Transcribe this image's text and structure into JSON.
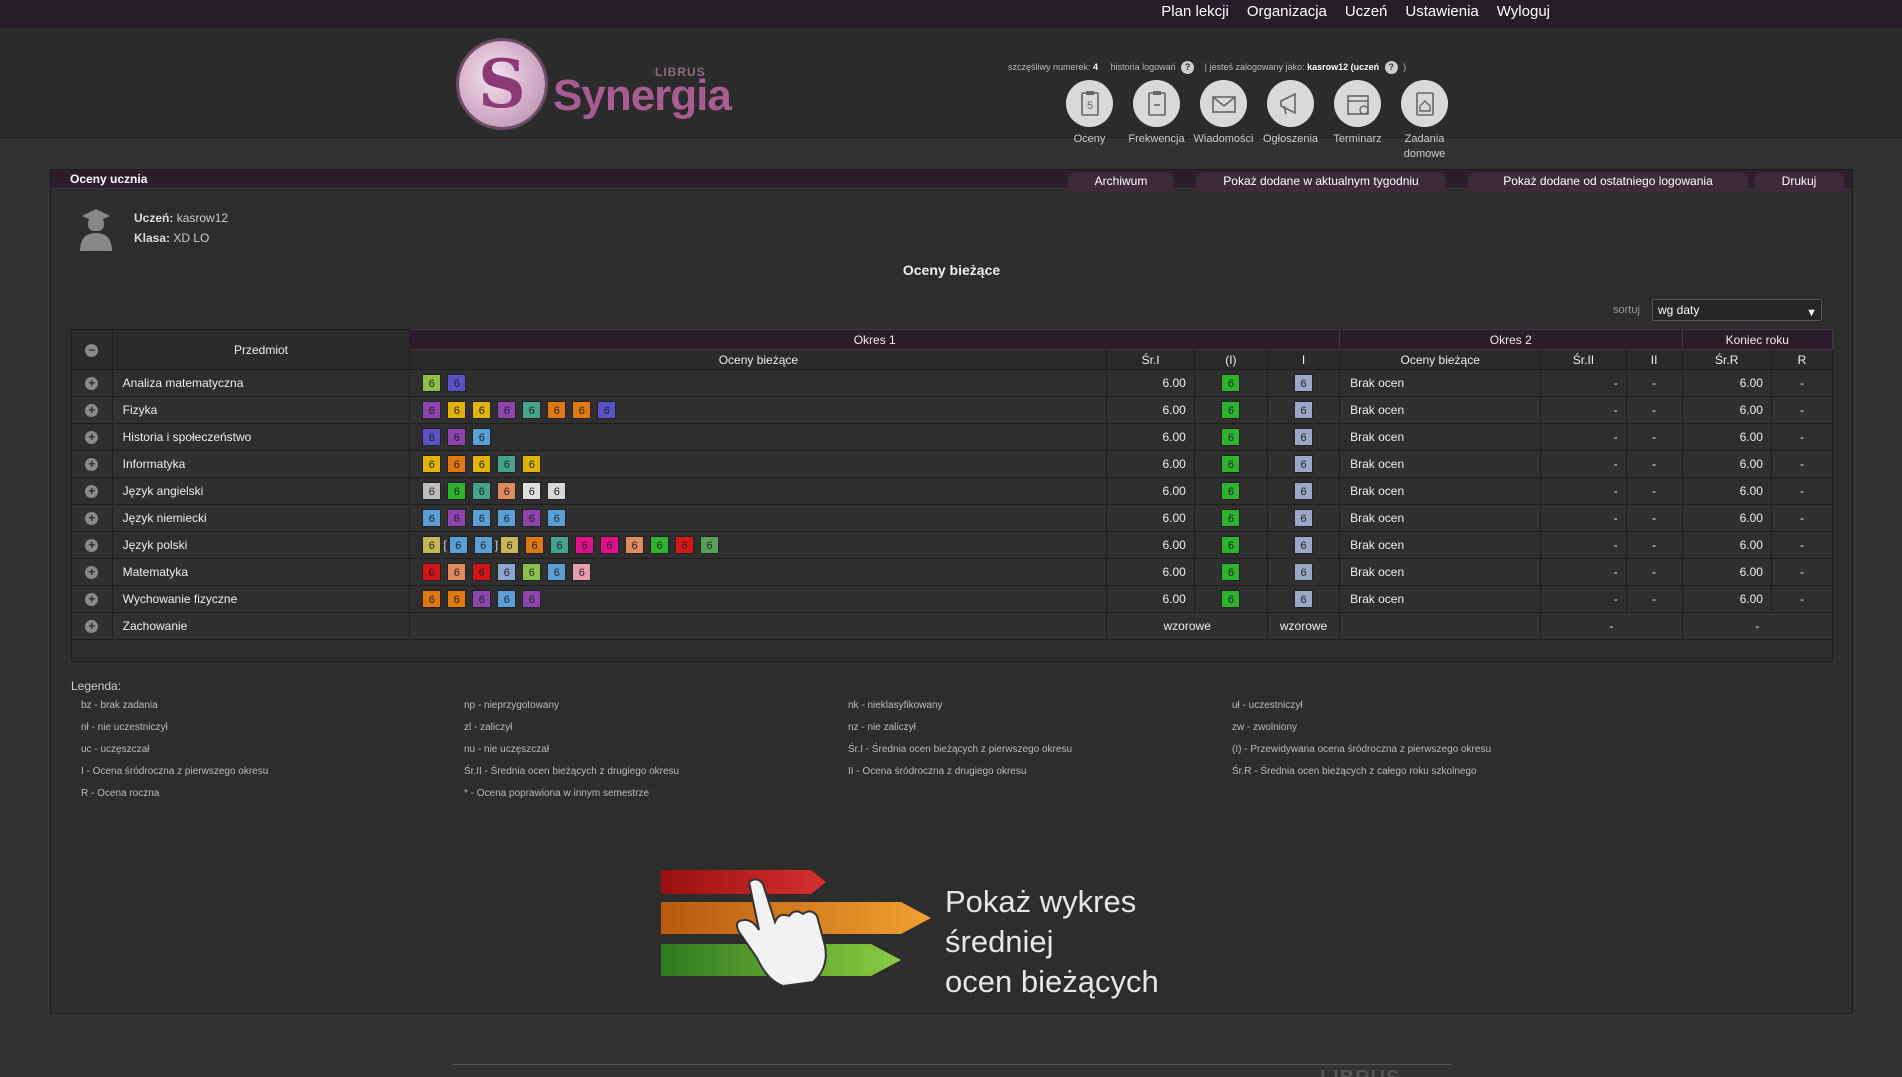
{
  "topnav": {
    "items": [
      "Plan lekcji",
      "Organizacja",
      "Uczeń",
      "Ustawienia",
      "Wyloguj"
    ]
  },
  "logo": {
    "name": "Synergia",
    "brand": "LIBRUS"
  },
  "infobar": {
    "lucky_label": "szczęśliwy numerek:",
    "lucky_value": "4",
    "history_label": "historia logowań",
    "logged_label": "| jesteś zalogowany jako:",
    "logged_value": "kasrow12 (uczeń",
    "close": ")"
  },
  "icons": [
    {
      "label": "Oceny",
      "icon": "grades-icon"
    },
    {
      "label": "Frekwencja",
      "icon": "attendance-icon"
    },
    {
      "label": "Wiadomości",
      "icon": "messages-icon"
    },
    {
      "label": "Ogłoszenia",
      "icon": "announcements-icon"
    },
    {
      "label": "Terminarz",
      "icon": "calendar-icon"
    },
    {
      "label": "Zadania domowe",
      "icon": "homework-icon"
    }
  ],
  "panel": {
    "title": "Oceny ucznia",
    "tabs": [
      "Archiwum",
      "Pokaż dodane w aktualnym tygodniu",
      "Pokaż dodane od ostatniego logowania",
      "Drukuj"
    ]
  },
  "student": {
    "name_label": "Uczeń:",
    "name": "kasrow12",
    "class_label": "Klasa:",
    "class": "XD LO"
  },
  "section_title": "Oceny bieżące",
  "sort": {
    "label": "sortuj",
    "value": "wg daty"
  },
  "table": {
    "headers": {
      "subject": "Przedmiot",
      "okres1": "Okres 1",
      "okres2": "Okres 2",
      "end": "Koniec roku",
      "grades1": "Oceny bieżące",
      "sr1": "Śr.I",
      "pred1": "(I)",
      "i": "I",
      "grades2": "Oceny bieżące",
      "sr2": "Śr.II",
      "ii": "II",
      "srr": "Śr.R",
      "r": "R"
    },
    "rows": [
      {
        "subject": "Analiza matematyczna",
        "grades": [
          {
            "v": "6",
            "c": "#8bc34a"
          },
          {
            "v": "6",
            "c": "#5a53c7"
          }
        ],
        "sr1": "6.00",
        "pred": "6",
        "i": "6",
        "grades2": "Brak ocen",
        "sr2": "-",
        "ii": "-",
        "srr": "6.00",
        "r": "-"
      },
      {
        "subject": "Fizyka",
        "grades": [
          {
            "v": "6",
            "c": "#8e44ad"
          },
          {
            "v": "6",
            "c": "#e0b400"
          },
          {
            "v": "6",
            "c": "#e0b400"
          },
          {
            "v": "6",
            "c": "#8e44ad"
          },
          {
            "v": "6",
            "c": "#45a58c"
          },
          {
            "v": "6",
            "c": "#e07a10"
          },
          {
            "v": "6",
            "c": "#e07a10"
          },
          {
            "v": "6",
            "c": "#5a53c7"
          }
        ],
        "sr1": "6.00",
        "pred": "6",
        "i": "6",
        "grades2": "Brak ocen",
        "sr2": "-",
        "ii": "-",
        "srr": "6.00",
        "r": "-"
      },
      {
        "subject": "Historia i społeczeństwo",
        "grades": [
          {
            "v": "6",
            "c": "#5a53c7"
          },
          {
            "v": "6",
            "c": "#8e44ad"
          },
          {
            "v": "6",
            "c": "#5a9fd6"
          }
        ],
        "sr1": "6.00",
        "pred": "6",
        "i": "6",
        "grades2": "Brak ocen",
        "sr2": "-",
        "ii": "-",
        "srr": "6.00",
        "r": "-"
      },
      {
        "subject": "Informatyka",
        "grades": [
          {
            "v": "6",
            "c": "#e0b400"
          },
          {
            "v": "6",
            "c": "#e07a10"
          },
          {
            "v": "6",
            "c": "#e0b400"
          },
          {
            "v": "6",
            "c": "#45a58c"
          },
          {
            "v": "6",
            "c": "#e0b400"
          }
        ],
        "sr1": "6.00",
        "pred": "6",
        "i": "6",
        "grades2": "Brak ocen",
        "sr2": "-",
        "ii": "-",
        "srr": "6.00",
        "r": "-"
      },
      {
        "subject": "Język angielski",
        "grades": [
          {
            "v": "6",
            "c": "#bdbdbd"
          },
          {
            "v": "6",
            "c": "#2db32d"
          },
          {
            "v": "6",
            "c": "#45a58c"
          },
          {
            "v": "6",
            "c": "#e08a60"
          },
          {
            "v": "6",
            "c": "#e0e0e0"
          },
          {
            "v": "6",
            "c": "#d8d8d8"
          }
        ],
        "sr1": "6.00",
        "pred": "6",
        "i": "6",
        "grades2": "Brak ocen",
        "sr2": "-",
        "ii": "-",
        "srr": "6.00",
        "r": "-"
      },
      {
        "subject": "Język niemiecki",
        "grades": [
          {
            "v": "6",
            "c": "#5a9fd6"
          },
          {
            "v": "6",
            "c": "#8e44ad"
          },
          {
            "v": "6",
            "c": "#5a9fd6"
          },
          {
            "v": "6",
            "c": "#5a9fd6"
          },
          {
            "v": "6",
            "c": "#8e44ad"
          },
          {
            "v": "6",
            "c": "#5a9fd6"
          }
        ],
        "sr1": "6.00",
        "pred": "6",
        "i": "6",
        "grades2": "Brak ocen",
        "sr2": "-",
        "ii": "-",
        "srr": "6.00",
        "r": "-"
      },
      {
        "subject": "Język polski",
        "special": true,
        "grades": [
          {
            "v": "6",
            "c": "#c9b458"
          },
          {
            "v": "[",
            "br": true
          },
          {
            "v": "6",
            "c": "#5a9fd6"
          },
          {
            "v": "6",
            "c": "#5a9fd6"
          },
          {
            "v": "]",
            "br": true
          },
          {
            "v": "6",
            "c": "#c9b458"
          },
          {
            "v": "6",
            "c": "#e07a10"
          },
          {
            "v": "6",
            "c": "#45a58c"
          },
          {
            "v": "6",
            "c": "#e0108a"
          },
          {
            "v": "6",
            "c": "#e0108a"
          },
          {
            "v": "6",
            "c": "#e08a60"
          },
          {
            "v": "6",
            "c": "#2db32d"
          },
          {
            "v": "6",
            "c": "#d41616"
          },
          {
            "v": "6",
            "c": "#5aa05a"
          }
        ],
        "sr1": "6.00",
        "pred": "6",
        "i": "6",
        "grades2": "Brak ocen",
        "sr2": "-",
        "ii": "-",
        "srr": "6.00",
        "r": "-"
      },
      {
        "subject": "Matematyka",
        "grades": [
          {
            "v": "6",
            "c": "#d41616"
          },
          {
            "v": "6",
            "c": "#e08a60"
          },
          {
            "v": "6",
            "c": "#d41616"
          },
          {
            "v": "6",
            "c": "#8ea5d0"
          },
          {
            "v": "6",
            "c": "#8bc34a"
          },
          {
            "v": "6",
            "c": "#5a9fd6"
          },
          {
            "v": "6",
            "c": "#e8a0b0"
          }
        ],
        "sr1": "6.00",
        "pred": "6",
        "i": "6",
        "grades2": "Brak ocen",
        "sr2": "-",
        "ii": "-",
        "srr": "6.00",
        "r": "-"
      },
      {
        "subject": "Wychowanie fizyczne",
        "grades": [
          {
            "v": "6",
            "c": "#e07a10"
          },
          {
            "v": "6",
            "c": "#e07a10"
          },
          {
            "v": "6",
            "c": "#8e44ad"
          },
          {
            "v": "6",
            "c": "#5a9fd6"
          },
          {
            "v": "6",
            "c": "#8e44ad"
          }
        ],
        "sr1": "6.00",
        "pred": "6",
        "i": "6",
        "grades2": "Brak ocen",
        "sr2": "-",
        "ii": "-",
        "srr": "6.00",
        "r": "-"
      }
    ],
    "behaviour": {
      "subject": "Zachowanie",
      "sr1": "wzorowe",
      "i": "wzorowe",
      "sr2": "-",
      "srr": "-"
    },
    "pred_color": "#2db32d",
    "i_color": "#9aa8c8"
  },
  "legend": {
    "title": "Legenda:",
    "items": [
      "bz - brak zadania",
      "np - nieprzygotowany",
      "nk - nieklasyfikowany",
      "uł - uczestniczył",
      "nł - nie uczestniczył",
      "zl - zaliczył",
      "nz - nie zaliczył",
      "zw - zwolniony",
      "uc - uczęszczał",
      "nu - nie uczęszczał",
      "Śr.I - Średnia ocen bieżących z pierwszego okresu",
      "(I) - Przewidywana ocena śródroczna z pierwszego okresu",
      "I - Ocena śródroczna z pierwszego okresu",
      "Śr.II - Średnia ocen bieżących z drugiego okresu",
      "II - Ocena śródroczna z drugiego okresu",
      "Śr.R - Średnia ocen bieżących z całego roku szkolnego",
      "R - Ocena roczna",
      "* - Ocena poprawiona w innym semestrze"
    ]
  },
  "promo": {
    "line1": "Pokaż wykres średniej",
    "line2": "ocen bieżących"
  },
  "footer": {
    "logo": "LIBRUS"
  }
}
